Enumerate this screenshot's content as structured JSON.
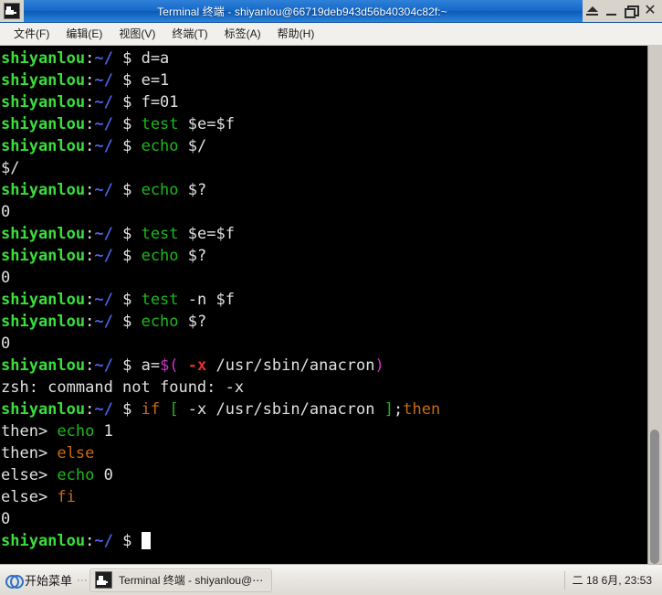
{
  "window": {
    "title": "Terminal 终端 - shiyanlou@66719deb943d56b40304c82f:~",
    "icon": "terminal-icon",
    "buttons": {
      "shade": "shade",
      "minimize": "_",
      "maximize": "maximize",
      "close": "✕"
    }
  },
  "menubar": {
    "items": [
      {
        "label": "文件(F)"
      },
      {
        "label": "编辑(E)"
      },
      {
        "label": "视图(V)"
      },
      {
        "label": "终端(T)"
      },
      {
        "label": "标签(A)"
      },
      {
        "label": "帮助(H)"
      }
    ]
  },
  "terminal": {
    "prompt": {
      "user": "shiyanlou",
      "colon": ":",
      "path": "~/",
      "dollar": "$"
    },
    "colors": {
      "background": "#000000",
      "user": "#3cdd3c",
      "path": "#4b63e8",
      "command": "#1db81d",
      "keyword": "#c96a12",
      "bracket": "#1db81d",
      "substitution": "#cc33cc",
      "error": "#e03030",
      "text": "#d8d8d8"
    },
    "lines": [
      {
        "type": "prompt",
        "segments": [
          {
            "t": "d=a",
            "c": "plain"
          }
        ]
      },
      {
        "type": "prompt",
        "segments": [
          {
            "t": "e=1",
            "c": "plain"
          }
        ]
      },
      {
        "type": "prompt",
        "segments": [
          {
            "t": "f=01",
            "c": "plain"
          }
        ]
      },
      {
        "type": "prompt",
        "segments": [
          {
            "t": "test",
            "c": "cmd"
          },
          {
            "t": " $e=$f",
            "c": "plain"
          }
        ]
      },
      {
        "type": "prompt",
        "segments": [
          {
            "t": "echo",
            "c": "cmd"
          },
          {
            "t": " $/",
            "c": "plain"
          }
        ]
      },
      {
        "type": "output",
        "segments": [
          {
            "t": "$/",
            "c": "plain"
          }
        ]
      },
      {
        "type": "prompt",
        "segments": [
          {
            "t": "echo",
            "c": "cmd"
          },
          {
            "t": " $?",
            "c": "plain"
          }
        ]
      },
      {
        "type": "output",
        "segments": [
          {
            "t": "0",
            "c": "plain"
          }
        ]
      },
      {
        "type": "prompt",
        "segments": [
          {
            "t": "test",
            "c": "cmd"
          },
          {
            "t": " $e=$f",
            "c": "plain"
          }
        ]
      },
      {
        "type": "prompt",
        "segments": [
          {
            "t": "echo",
            "c": "cmd"
          },
          {
            "t": " $?",
            "c": "plain"
          }
        ]
      },
      {
        "type": "output",
        "segments": [
          {
            "t": "0",
            "c": "plain"
          }
        ]
      },
      {
        "type": "prompt",
        "segments": [
          {
            "t": "test",
            "c": "cmd"
          },
          {
            "t": " -n $f",
            "c": "plain"
          }
        ]
      },
      {
        "type": "prompt",
        "segments": [
          {
            "t": "echo",
            "c": "cmd"
          },
          {
            "t": " $?",
            "c": "plain"
          }
        ]
      },
      {
        "type": "output",
        "segments": [
          {
            "t": "0",
            "c": "plain"
          }
        ]
      },
      {
        "type": "prompt",
        "segments": [
          {
            "t": "a=",
            "c": "plain"
          },
          {
            "t": "$(",
            "c": "subst"
          },
          {
            "t": " ",
            "c": "plain"
          },
          {
            "t": "-x",
            "c": "err"
          },
          {
            "t": " /usr/sbin/anacron",
            "c": "plain"
          },
          {
            "t": ")",
            "c": "subst"
          }
        ]
      },
      {
        "type": "output",
        "segments": [
          {
            "t": "zsh: command not found: -x",
            "c": "plain"
          }
        ]
      },
      {
        "type": "prompt",
        "segments": [
          {
            "t": "if",
            "c": "kw"
          },
          {
            "t": " ",
            "c": "plain"
          },
          {
            "t": "[",
            "c": "brk"
          },
          {
            "t": " -x /usr/sbin/anacron ",
            "c": "plain"
          },
          {
            "t": "]",
            "c": "brk"
          },
          {
            "t": ";",
            "c": "plain"
          },
          {
            "t": "then",
            "c": "kw"
          }
        ]
      },
      {
        "type": "cont",
        "cont_label": "then>",
        "segments": [
          {
            "t": "echo",
            "c": "cmd"
          },
          {
            "t": " 1",
            "c": "plain"
          }
        ]
      },
      {
        "type": "cont",
        "cont_label": "then>",
        "segments": [
          {
            "t": "else",
            "c": "kw"
          }
        ]
      },
      {
        "type": "cont",
        "cont_label": "else>",
        "segments": [
          {
            "t": "echo",
            "c": "cmd"
          },
          {
            "t": " 0",
            "c": "plain"
          }
        ]
      },
      {
        "type": "cont",
        "cont_label": "else>",
        "segments": [
          {
            "t": "fi",
            "c": "kw"
          }
        ]
      },
      {
        "type": "output",
        "segments": [
          {
            "t": "0",
            "c": "plain"
          }
        ]
      },
      {
        "type": "prompt",
        "segments": [],
        "cursor": true
      }
    ]
  },
  "scrollbar": {
    "thumb_top_pct": 74,
    "thumb_height_pct": 26
  },
  "taskbar": {
    "start_label": "开始菜单",
    "start_icon": "start-menu-icon",
    "grip": "⋮",
    "task_icon": "terminal-icon",
    "task_label": "Terminal 终端 - shiyanlou@⋯",
    "clock": "二 18 6月, 23:53"
  }
}
